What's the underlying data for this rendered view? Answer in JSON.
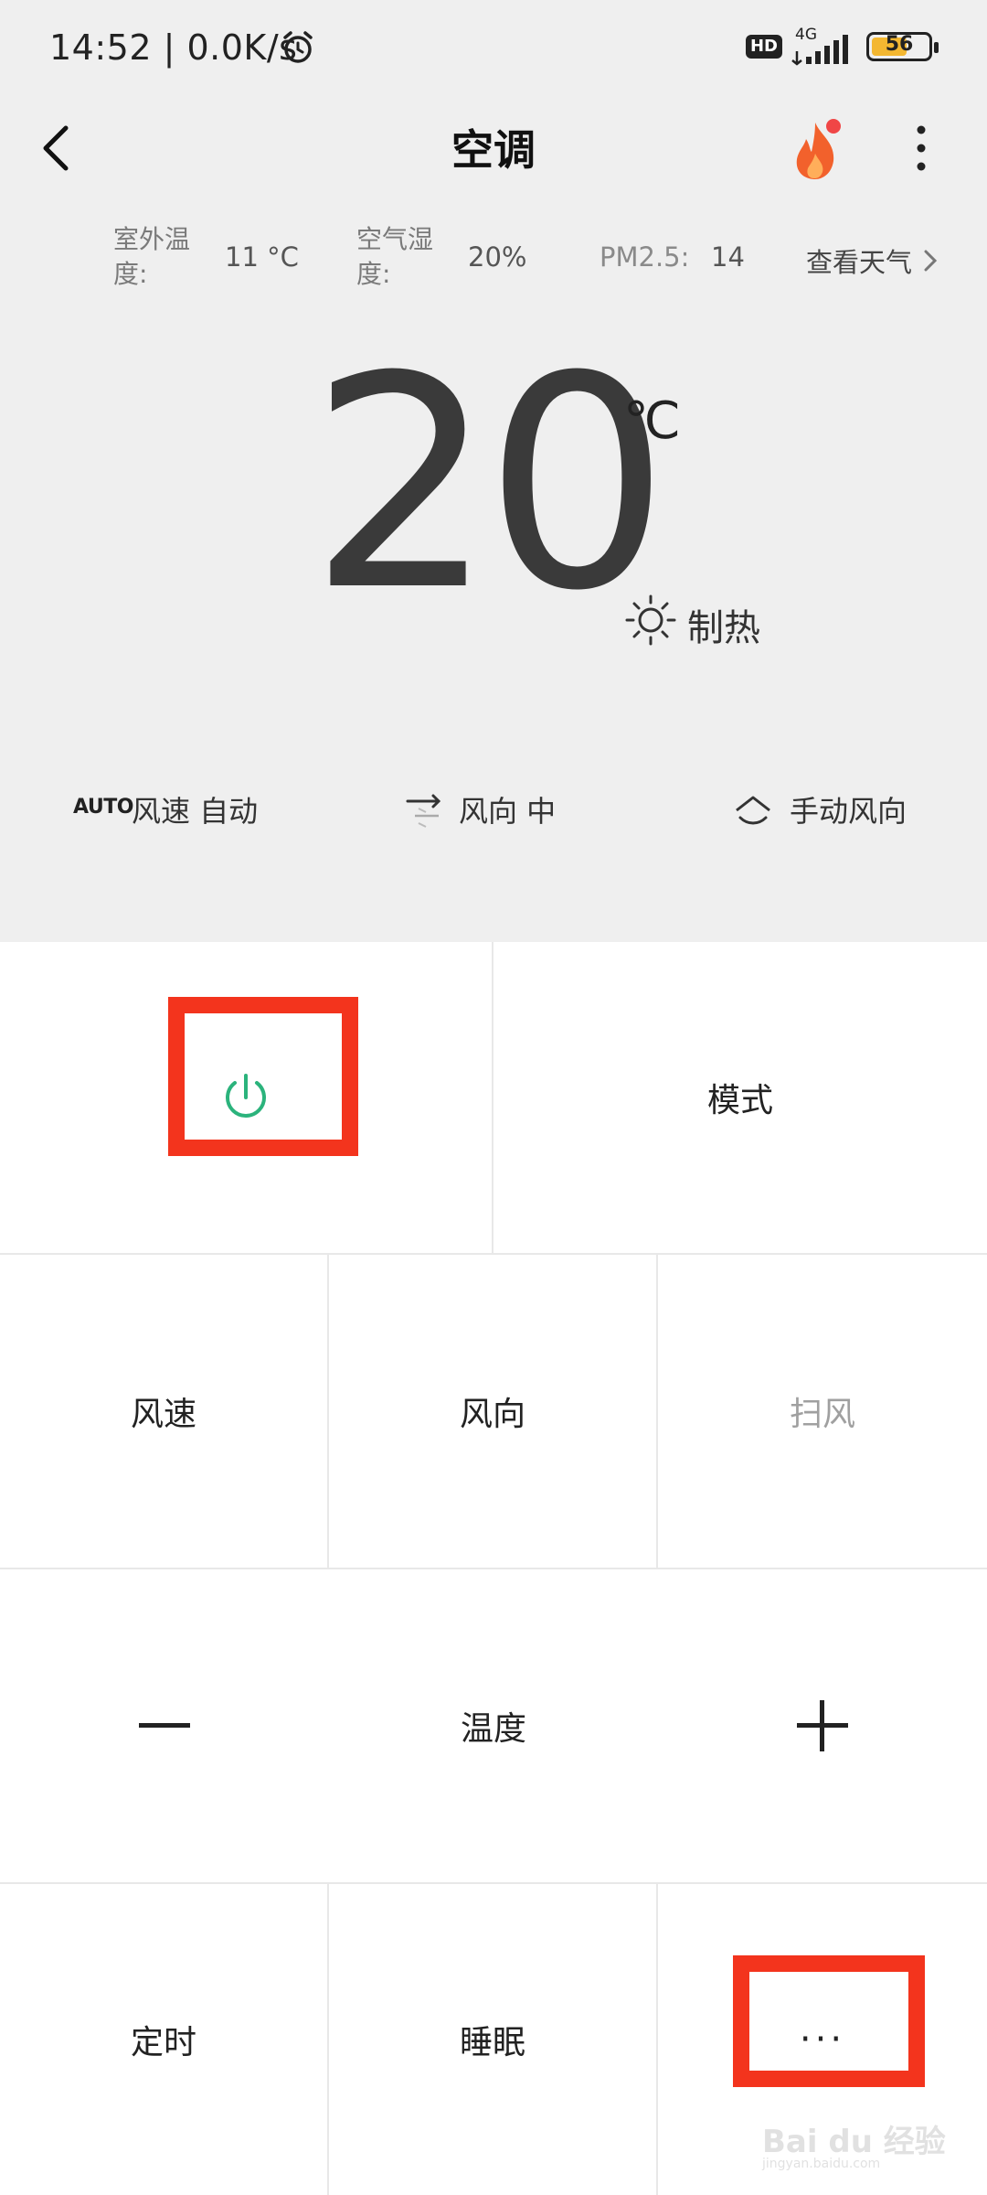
{
  "status_bar": {
    "time": "14:52 | 0.0K/s",
    "hd": "HD",
    "network": "4G",
    "battery": "56"
  },
  "header": {
    "title": "空调",
    "back_icon": "back-arrow-icon",
    "hot_icon": "flame-icon",
    "more_icon": "more-vertical-icon"
  },
  "weather": {
    "outdoor_label_1": "室外温",
    "outdoor_label_2": "度:",
    "outdoor_value": "11 °C",
    "humidity_label_1": "空气湿",
    "humidity_label_2": "度:",
    "humidity_value": "20%",
    "pm_label": "PM2.5:",
    "pm_value": "14",
    "link": "查看天气"
  },
  "display": {
    "temperature": "20",
    "unit": "℃",
    "mode": "制热",
    "mode_icon": "sun-icon"
  },
  "status_row": {
    "auto_badge": "AUTO",
    "fan_speed": "风速 自动",
    "direction": "风向 中",
    "manual_direction": "手动风向"
  },
  "controls": {
    "power_icon": "power-icon",
    "mode": "模式",
    "fan_speed": "风速",
    "direction": "风向",
    "swing": "扫风",
    "temp_label": "温度",
    "minus": "—",
    "plus": "+",
    "timer": "定时",
    "sleep": "睡眠",
    "more": "···"
  },
  "watermark": {
    "text": "Bai du 经验",
    "sub": "jingyan.baidu.com"
  },
  "colors": {
    "power_green": "#2bb37c",
    "highlight_red": "#f3341d",
    "flame_orange": "#f2612c"
  }
}
